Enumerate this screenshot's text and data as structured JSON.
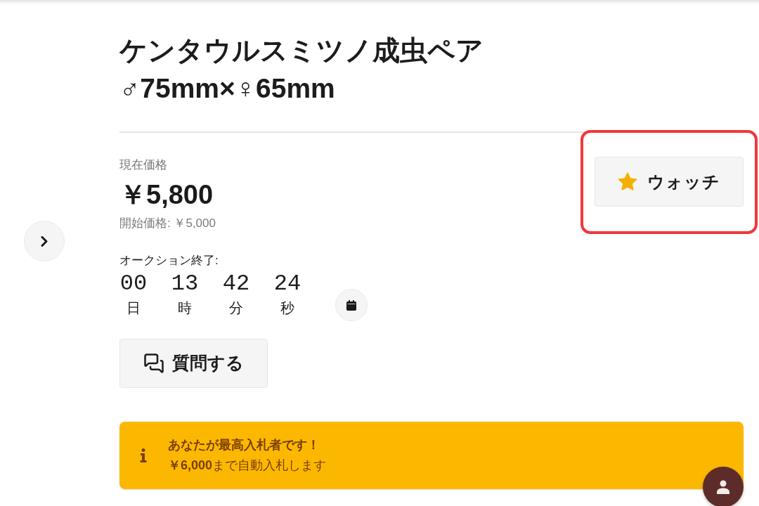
{
  "product": {
    "title_lines": [
      "ケンタウルスミツノ成虫ペア",
      "♂75mm×♀65mm"
    ]
  },
  "price": {
    "current_label": "現在価格",
    "current": "￥5,800",
    "start": "開始価格: ￥5,000"
  },
  "watch_button": {
    "label": "ウォッチ",
    "highlighted": true
  },
  "auction_end": {
    "label": "オークション終了:",
    "countdown": [
      {
        "value": "00",
        "unit": "日"
      },
      {
        "value": "13",
        "unit": "時"
      },
      {
        "value": "42",
        "unit": "分"
      },
      {
        "value": "24",
        "unit": "秒"
      }
    ]
  },
  "question_button": {
    "label": "質問する"
  },
  "notice": {
    "title": "あなたが最高入札者です！",
    "detail": "**￥6,000**まで自動入札します"
  }
}
